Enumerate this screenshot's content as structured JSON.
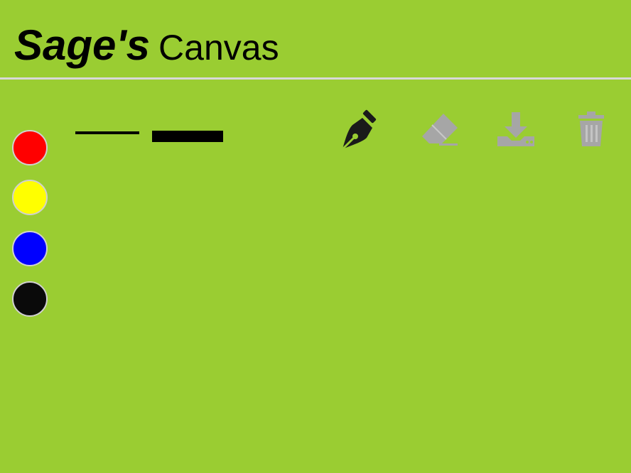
{
  "header": {
    "title_bold": "Sage's",
    "title_regular": "Canvas"
  },
  "palette": {
    "colors": [
      {
        "name": "red",
        "hex": "#ff0000"
      },
      {
        "name": "yellow",
        "hex": "#ffff00"
      },
      {
        "name": "blue",
        "hex": "#0000ff"
      },
      {
        "name": "black",
        "hex": "#0a0a0a"
      }
    ]
  },
  "stroke_widths": [
    "thin",
    "thick"
  ],
  "tools": {
    "pen": {
      "icon": "pen-nib-icon",
      "color": "#1a1a1a",
      "active": true
    },
    "eraser": {
      "icon": "eraser-icon",
      "color": "#a6a6a6",
      "active": false
    },
    "download": {
      "icon": "download-icon",
      "color": "#a6a6a6",
      "active": false
    },
    "clear": {
      "icon": "trash-icon",
      "color": "#a6a6a6",
      "active": false
    }
  },
  "colors": {
    "background": "#9acd32",
    "divider": "#d9d9d9"
  }
}
